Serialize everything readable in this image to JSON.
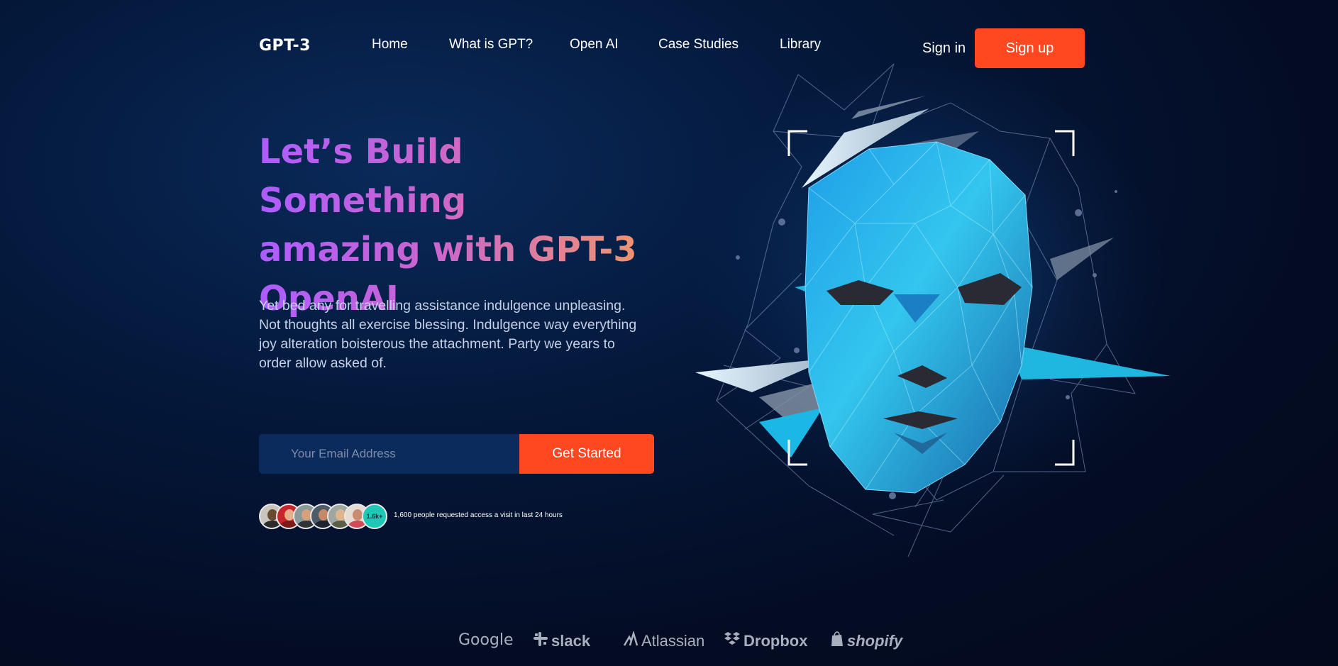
{
  "nav": {
    "logo": "GPT-3",
    "links": [
      "Home",
      "What is GPT?",
      "Open AI",
      "Case Studies",
      "Library"
    ],
    "sign_in": "Sign in",
    "sign_up": "Sign up"
  },
  "hero": {
    "headline_lines": [
      "Let’s Build Something",
      "amazing with GPT-3",
      "OpenAI"
    ],
    "description": "Yet bed any for travelling assistance indulgence unpleasing. Not thoughts all exercise blessing. Indulgence way everything joy alteration boisterous the attachment. Party we years to order allow asked of.",
    "email_placeholder": "Your Email Address",
    "cta": "Get Started",
    "avatar_count_badge": "1.6k+",
    "social_proof": "1,600 people requested access a visit in last 24 hours"
  },
  "brands": [
    "Google",
    "slack",
    "Atlassian",
    "Dropbox",
    "shopify"
  ],
  "colors": {
    "accent": "#ff4820",
    "headline_gradient": [
      "#ad5cff",
      "#f49867"
    ],
    "background": "#040c24",
    "face": "#2a9be0"
  }
}
